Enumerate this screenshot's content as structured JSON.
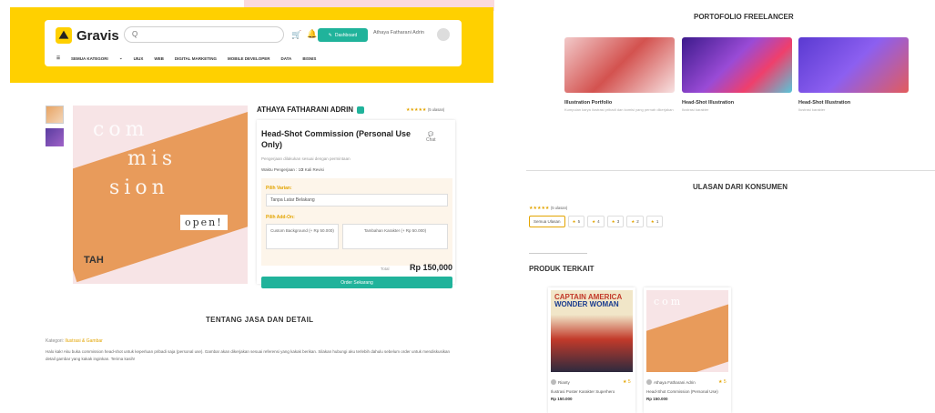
{
  "header": {
    "brand": "Gravis",
    "search_placeholder": "Q",
    "dashboard_label": "Dashboard",
    "user_name": "Athaya Fatharani Adrin",
    "nav": [
      "SEMUA KATEGORI",
      "UIUX",
      "WEB",
      "DIGITAL MARKETING",
      "MOBILE DEVELOPER",
      "DATA",
      "BISNIS"
    ]
  },
  "product": {
    "seller_name": "ATHAYA FATHARANI ADRIN",
    "rating_text": "★★★★★",
    "rating_count": "(5 ulasan)",
    "title": "Head-Shot Commission (Personal Use Only)",
    "chat_label": "Chat",
    "subtitle": "Pengerjaan dilakukan sesuai dengan permintaan",
    "waktu": "Waktu Pengerjaan : 10",
    "revisi": "2 Kali Revisi",
    "pilih_varian": "Pilih Varian:",
    "varian_selected": "Tanpa Latar Belakang",
    "pilih_addon": "Pilih Add-On:",
    "addon1": "Custom Background (+ Rp 50.000)",
    "addon2": "Tambahan Karakter (+ Rp 50.000)",
    "total_label": "Total",
    "price": "Rp 150,000",
    "order_label": "Order Sekarang"
  },
  "hero": {
    "line1": "com",
    "line2": "mis",
    "line3": "sion",
    "open": "open!",
    "sig": "TAH"
  },
  "detail": {
    "heading": "TENTANG JASA DAN DETAIL",
    "kategori_label": "Kategori:",
    "kategori_value": "Ilustrasi & Gambar",
    "description": "Halo kak! Aku buka commission head-shot untuk keperluan pribadi saja (personal use). Gambar akan dikerjakan sesuai referensi yang kakak berikan. Silakan hubungi aku terlebih dahulu sebelum order untuk mendiskusikan detail gambar yang kakak inginkan. Terima kasih!"
  },
  "portfolio": {
    "heading": "PORTOFOLIO FREELANCER",
    "items": [
      {
        "label": "Illustration Portfolio",
        "desc": "Kumpulan karya ilustrasi pribadi dan komisi yang pernah dikerjakan"
      },
      {
        "label": "Head-Shot Illustration",
        "desc": "Ilustrasi karakter"
      },
      {
        "label": "Head-Shot Illustration",
        "desc": "Ilustrasi karakter"
      }
    ]
  },
  "reviews": {
    "heading": "ULASAN DARI KONSUMEN",
    "summary_stars": "★★★★★",
    "summary_count": "(5 ulasan)",
    "filters": [
      "Semua Ulasan",
      "5",
      "4",
      "3",
      "2",
      "1"
    ]
  },
  "related": {
    "heading": "PRODUK TERKAIT",
    "items": [
      {
        "cap1": "CAPTAIN AMERICA",
        "cap2": "WONDER WOMAN",
        "seller": "Rianty",
        "rating": "5",
        "name": "Ilustrasi Poster Karakter Superhero",
        "price": "Rp 150.000"
      },
      {
        "cap1": "",
        "cap2": "",
        "seller": "Athaya Fatharani Adrin",
        "rating": "5",
        "name": "Head-Shot Commission (Personal Use)",
        "price": "Rp 150.000"
      }
    ]
  },
  "colors": {
    "accent": "#20b39b",
    "header_bg": "#ffd000",
    "star": "#e3a400"
  }
}
